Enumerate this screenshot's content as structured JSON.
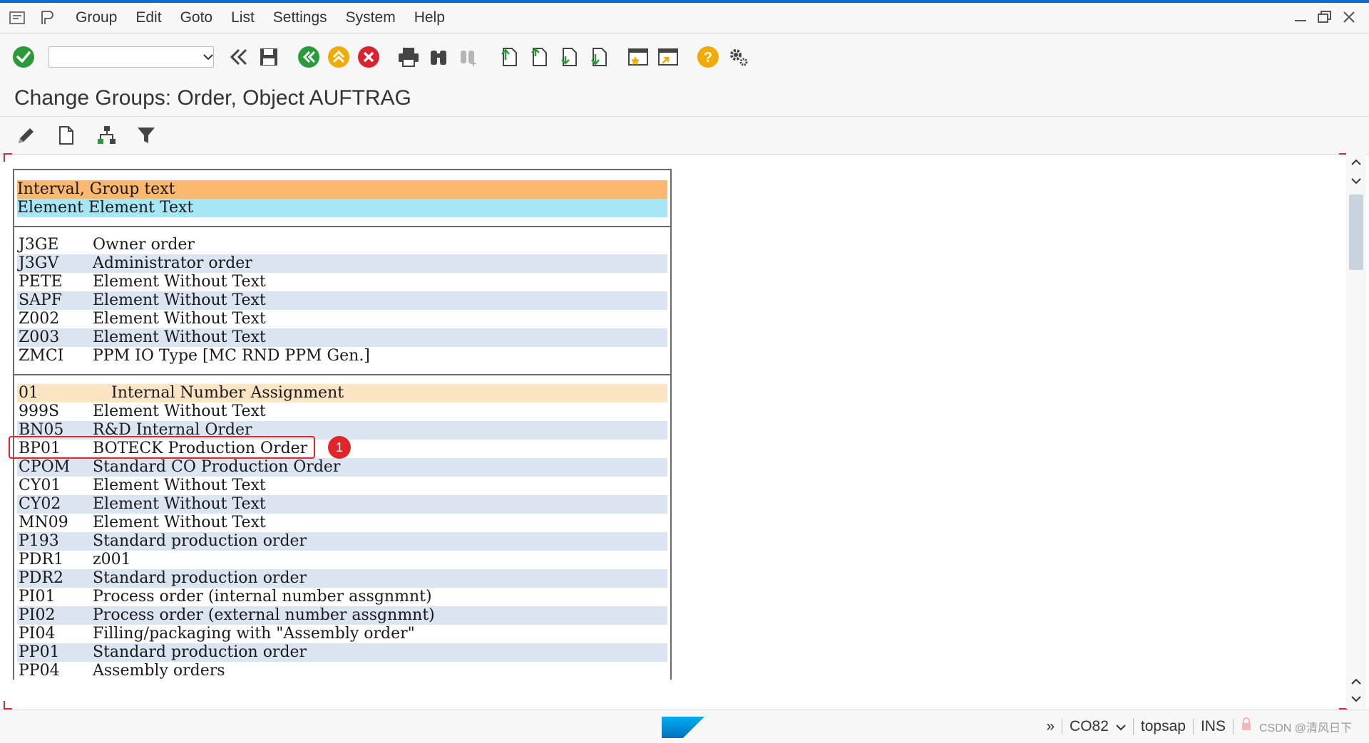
{
  "menu": {
    "items": [
      "Group",
      "Edit",
      "Goto",
      "List",
      "Settings",
      "System",
      "Help"
    ]
  },
  "toolbar": {
    "command_value": ""
  },
  "page": {
    "title": "Change Groups: Order, Object AUFTRAG"
  },
  "list": {
    "header1": "Interval, Group text",
    "header2": "Element Element Text",
    "section1": [
      {
        "code": "J3GE",
        "text": "Owner order"
      },
      {
        "code": "J3GV",
        "text": "Administrator order"
      },
      {
        "code": "PETE",
        "text": "Element Without Text"
      },
      {
        "code": "SAPF",
        "text": "Element Without Text"
      },
      {
        "code": "Z002",
        "text": "Element Without Text"
      },
      {
        "code": "Z003",
        "text": "Element Without Text"
      },
      {
        "code": "ZMCI",
        "text": "PPM IO Type [MC RND PPM Gen.]"
      }
    ],
    "group_row": {
      "code": "01",
      "text": "Internal Number Assignment"
    },
    "section2": [
      {
        "code": "999S",
        "text": "Element Without Text"
      },
      {
        "code": "BN05",
        "text": "R&D Internal Order"
      },
      {
        "code": "BP01",
        "text": "BOTECK Production Order"
      },
      {
        "code": "CPOM",
        "text": "Standard CO Production Order"
      },
      {
        "code": "CY01",
        "text": "Element Without Text"
      },
      {
        "code": "CY02",
        "text": "Element Without Text"
      },
      {
        "code": "MN09",
        "text": "Element Without Text"
      },
      {
        "code": "P193",
        "text": "Standard production order"
      },
      {
        "code": "PDR1",
        "text": "z001"
      },
      {
        "code": "PDR2",
        "text": "Standard production order"
      },
      {
        "code": "PI01",
        "text": "Process order (internal number assgnmnt)"
      },
      {
        "code": "PI02",
        "text": "Process order (external number assgnmnt)"
      },
      {
        "code": "PI04",
        "text": "Filling/packaging with \"Assembly order\""
      },
      {
        "code": "PP01",
        "text": "Standard production order"
      },
      {
        "code": "PP04",
        "text": "Assembly orders"
      }
    ]
  },
  "annotation": {
    "badge": "1"
  },
  "status": {
    "chevron": "»",
    "transaction": "CO82",
    "server": "topsap",
    "mode": "INS",
    "watermark": "CSDN @清风日下"
  },
  "colors": {
    "accent": "#0a6ed1",
    "header1": "#fdb870",
    "header2": "#a6e6f5",
    "group": "#fae4c4",
    "alt_row": "#dbe5f1",
    "highlight": "#e0262b"
  }
}
